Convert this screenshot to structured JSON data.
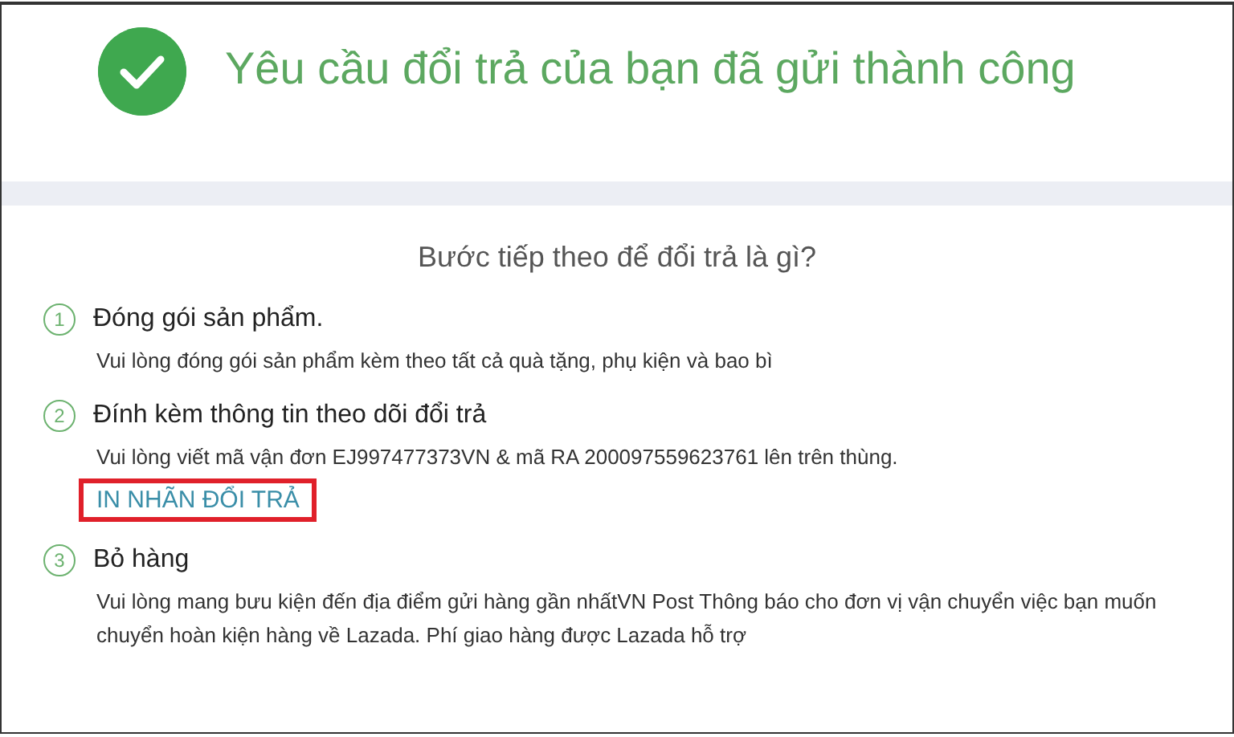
{
  "header": {
    "title": "Yêu cầu đổi trả của bạn đã gửi thành công"
  },
  "next_steps": {
    "heading": "Bước tiếp theo để đổi trả là gì?",
    "steps": [
      {
        "number": "1",
        "title": "Đóng gói sản phẩm.",
        "description": "Vui lòng đóng gói sản phẩm kèm theo tất cả quà tặng, phụ kiện và bao bì"
      },
      {
        "number": "2",
        "title": "Đính kèm thông tin theo dõi đổi trả",
        "description": "Vui lòng viết mã vận đơn EJ997477373VN & mã RA 200097559623761 lên trên thùng.",
        "link": {
          "label": "IN NHÃN ĐỔI TRẢ",
          "highlighted": true
        }
      },
      {
        "number": "3",
        "title": "Bỏ hàng",
        "description": "Vui lòng mang bưu kiện đến địa điểm gửi hàng gần nhấtVN Post Thông báo cho đơn vị vận chuyển việc bạn muốn chuyển hoàn kiện hàng về Lazada. Phí giao hàng được Lazada hỗ trợ"
      }
    ]
  }
}
